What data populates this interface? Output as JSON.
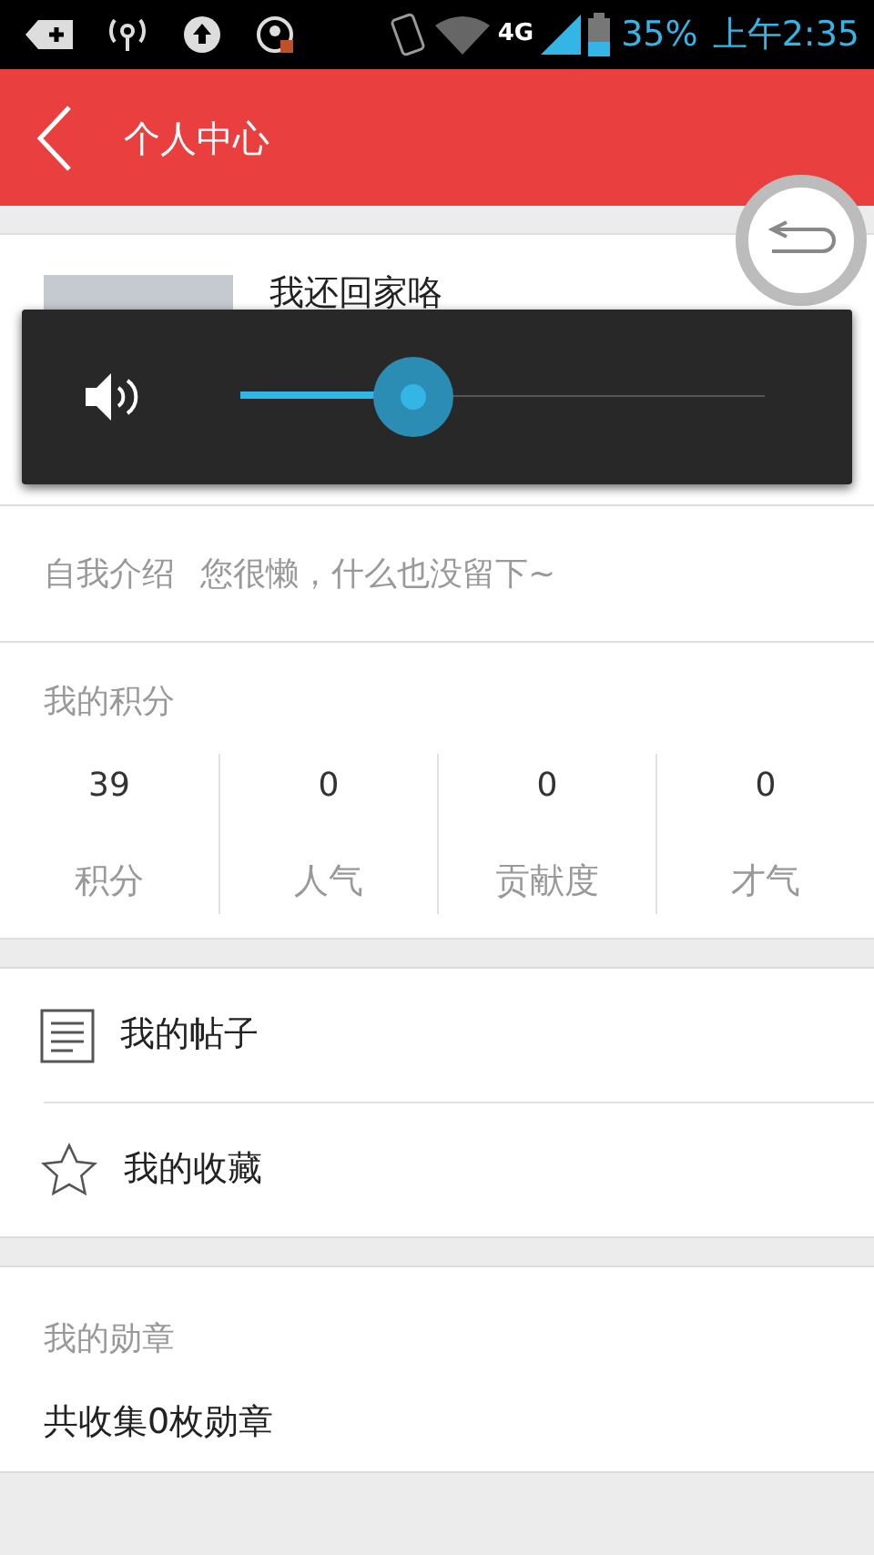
{
  "status_bar": {
    "network": "4G",
    "battery": "35%",
    "time": "上午2:35"
  },
  "header": {
    "title": "个人中心"
  },
  "profile": {
    "name": "我还回家咯"
  },
  "volume_overlay": {
    "level": 0.33
  },
  "intro": {
    "label": "自我介绍",
    "value": "您很懒，什么也没留下~"
  },
  "points": {
    "title": "我的积分",
    "stats": [
      {
        "value": "39",
        "label": "积分"
      },
      {
        "value": "0",
        "label": "人气"
      },
      {
        "value": "0",
        "label": "贡献度"
      },
      {
        "value": "0",
        "label": "才气"
      }
    ]
  },
  "menu": [
    {
      "kind": "posts",
      "label": "我的帖子"
    },
    {
      "kind": "favorites",
      "label": "我的收藏"
    }
  ],
  "medals": {
    "title": "我的勋章",
    "summary": "共收集0枚勋章"
  }
}
